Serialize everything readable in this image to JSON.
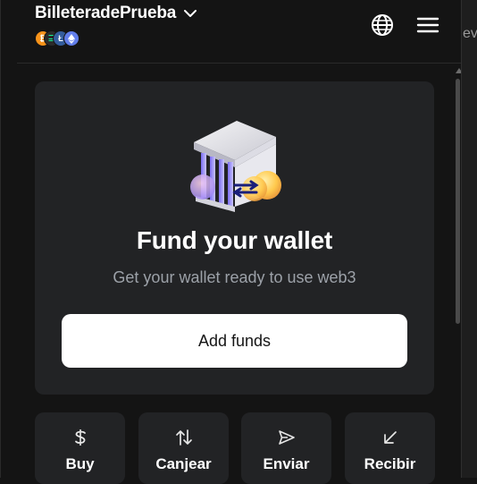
{
  "header": {
    "wallet_name": "BilleteradePrueba",
    "networks": [
      {
        "name": "bitcoin",
        "color": "#f7931a"
      },
      {
        "name": "solana",
        "color": "#7c7cff"
      },
      {
        "name": "litecoin",
        "color": "#345d9d"
      },
      {
        "name": "ethereum",
        "color": "#627eea"
      }
    ],
    "icons": {
      "dropdown": "chevron-down-icon",
      "language": "globe-icon",
      "menu": "hamburger-menu-icon"
    }
  },
  "side_peek_text": "ev",
  "card": {
    "title": "Fund your wallet",
    "subtitle": "Get your wallet ready to use web3",
    "button_label": "Add funds",
    "illustration": "bank-with-coins-illustration"
  },
  "actions": [
    {
      "label": "Buy",
      "icon": "dollar-icon"
    },
    {
      "label": "Canjear",
      "icon": "swap-arrows-icon"
    },
    {
      "label": "Enviar",
      "icon": "send-icon"
    },
    {
      "label": "Recibir",
      "icon": "receive-arrow-icon"
    }
  ],
  "colors": {
    "background": "#141414",
    "card": "#222325",
    "muted_text": "#9ca1a8",
    "button_bg": "#ffffff"
  }
}
